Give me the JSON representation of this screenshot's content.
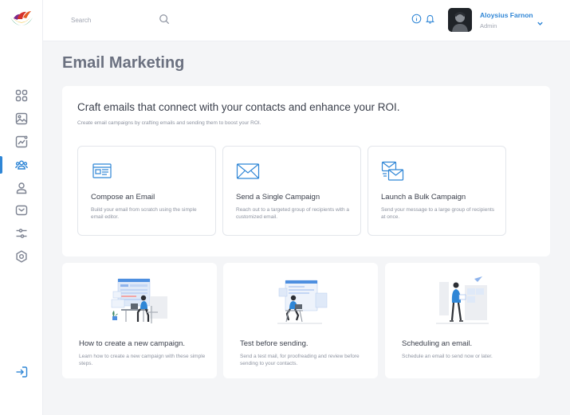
{
  "header": {
    "search_placeholder": "Search",
    "user": {
      "name": "Aloysius Farnon",
      "role": "Admin"
    }
  },
  "sidebar": {
    "items": [
      {
        "icon": "dashboard-icon"
      },
      {
        "icon": "image-icon"
      },
      {
        "icon": "analytics-icon"
      },
      {
        "icon": "contacts-icon",
        "active": true
      },
      {
        "icon": "user-icon"
      },
      {
        "icon": "mail-icon"
      },
      {
        "icon": "filters-icon"
      },
      {
        "icon": "settings-icon"
      }
    ],
    "logout_icon": "logout-icon"
  },
  "page": {
    "title": "Email Marketing"
  },
  "panel": {
    "heading": "Craft emails that connect with your contacts and enhance your ROI.",
    "subheading": "Create email campaigns by crafting emails and sending them to boost your ROI.",
    "actions": [
      {
        "icon": "compose-email-icon",
        "title": "Compose an Email",
        "desc": "Build your email from scratch using the simple email editor."
      },
      {
        "icon": "single-campaign-icon",
        "title": "Send a Single Campaign",
        "desc": "Reach out to a targeted group of recipients with a customized email."
      },
      {
        "icon": "bulk-campaign-icon",
        "title": "Launch a Bulk Campaign",
        "desc": "Send your message to a large group of recipients at once."
      }
    ]
  },
  "guides": [
    {
      "title": "How to create a new campaign.",
      "desc": "Learn how to create a new campaign with these simple steps."
    },
    {
      "title": "Test before sending.",
      "desc": "Send a test mail, for proofreading and review before sending to your contacts."
    },
    {
      "title": "Scheduling an email.",
      "desc": "Schedule an email to send now or later."
    }
  ],
  "colors": {
    "accent": "#2f86d6",
    "background": "#f4f5f7",
    "title": "#6b7180"
  }
}
